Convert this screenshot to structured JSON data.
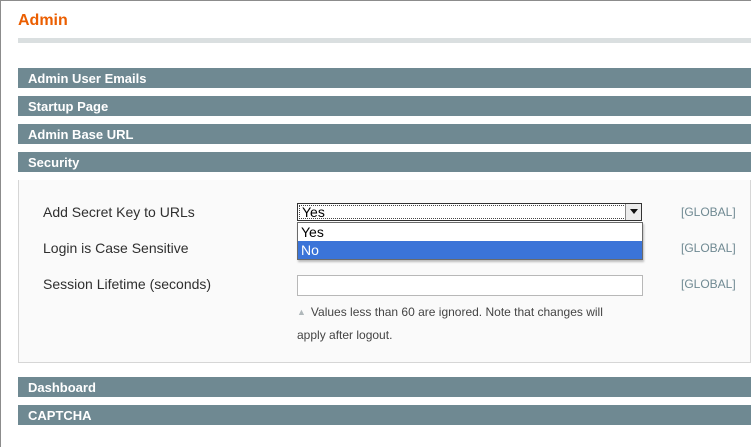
{
  "page": {
    "title": "Admin"
  },
  "sections": [
    {
      "label": "Admin User Emails"
    },
    {
      "label": "Startup Page"
    },
    {
      "label": "Admin Base URL"
    },
    {
      "label": "Security"
    },
    {
      "label": "Dashboard"
    },
    {
      "label": "CAPTCHA"
    }
  ],
  "security": {
    "fields": [
      {
        "label": "Add Secret Key to URLs",
        "scope": "[GLOBAL]",
        "value": "Yes"
      },
      {
        "label": "Login is Case Sensitive",
        "scope": "[GLOBAL]"
      },
      {
        "label": "Session Lifetime (seconds)",
        "scope": "[GLOBAL]",
        "value": ""
      }
    ],
    "dropdown_options": [
      {
        "label": "Yes"
      },
      {
        "label": "No"
      }
    ],
    "highlighted_option": "No",
    "session_note_line1": "Values less than 60 are ignored. Note that changes will",
    "session_note_line2": "apply after logout."
  },
  "icons": {
    "select_arrow": "chevron-down-icon",
    "note_marker": "triangle-up-icon"
  },
  "colors": {
    "title": "#eb5e00",
    "section_bar": "#6f8992",
    "scope_text": "#6f8992",
    "highlight": "#3b74d8"
  }
}
